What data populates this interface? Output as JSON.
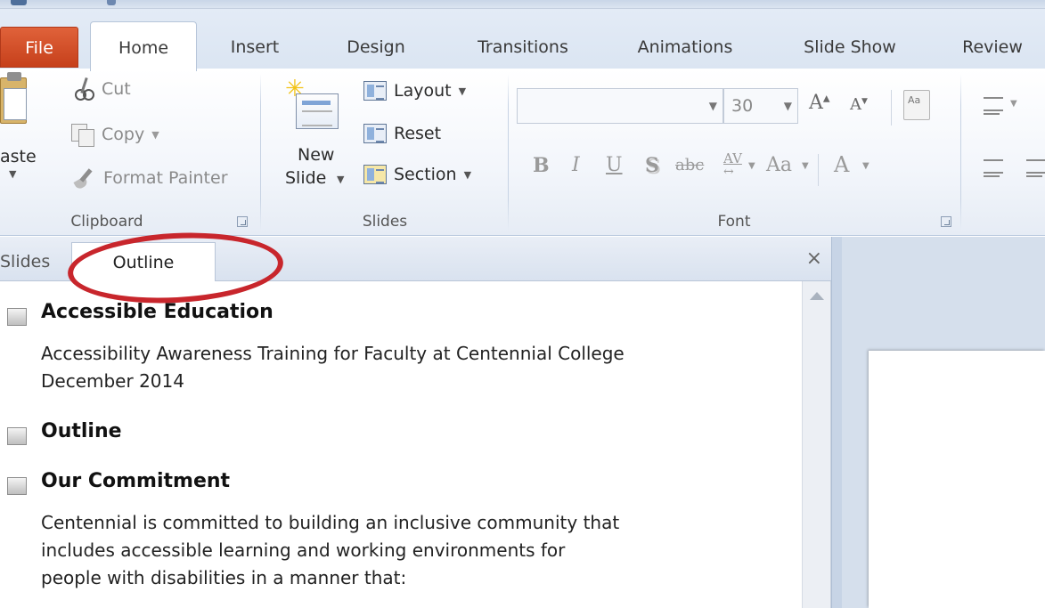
{
  "tabs": {
    "file": "File",
    "home": "Home",
    "insert": "Insert",
    "design": "Design",
    "transitions": "Transitions",
    "animations": "Animations",
    "slide_show": "Slide Show",
    "review": "Review"
  },
  "clipboard": {
    "paste": "aste",
    "cut": "Cut",
    "copy": "Copy",
    "format_painter": "Format Painter",
    "label": "Clipboard"
  },
  "slides_group": {
    "new_slide_line1": "New",
    "new_slide_line2": "Slide",
    "layout": "Layout",
    "reset": "Reset",
    "section": "Section",
    "label": "Slides"
  },
  "font_group": {
    "font_name": "",
    "font_size": "30",
    "bold": "B",
    "italic": "I",
    "underline": "U",
    "shadow": "S",
    "strikethrough": "abc",
    "spacing": "AV",
    "change_case": "Aa",
    "grow": "A",
    "shrink": "A",
    "font_color": "A",
    "label": "Font"
  },
  "pane": {
    "tab_slides": "Slides",
    "tab_outline": "Outline",
    "close": "×"
  },
  "outline": [
    {
      "title": "Accessible Education",
      "body": "Accessibility  Awareness Training for Faculty at Centennial  College\nDecember 2014"
    },
    {
      "title": "Outline",
      "body": ""
    },
    {
      "title": "Our Commitment",
      "body": "Centennial is committed to building  an inclusive community that\nincludes accessible learning and working environments for\npeople with disabilities in a manner that:"
    }
  ],
  "colors": {
    "file_tab": "#c6401b",
    "annotation_ring": "#c8262c",
    "ribbon_bg": "#f3f6fb"
  }
}
